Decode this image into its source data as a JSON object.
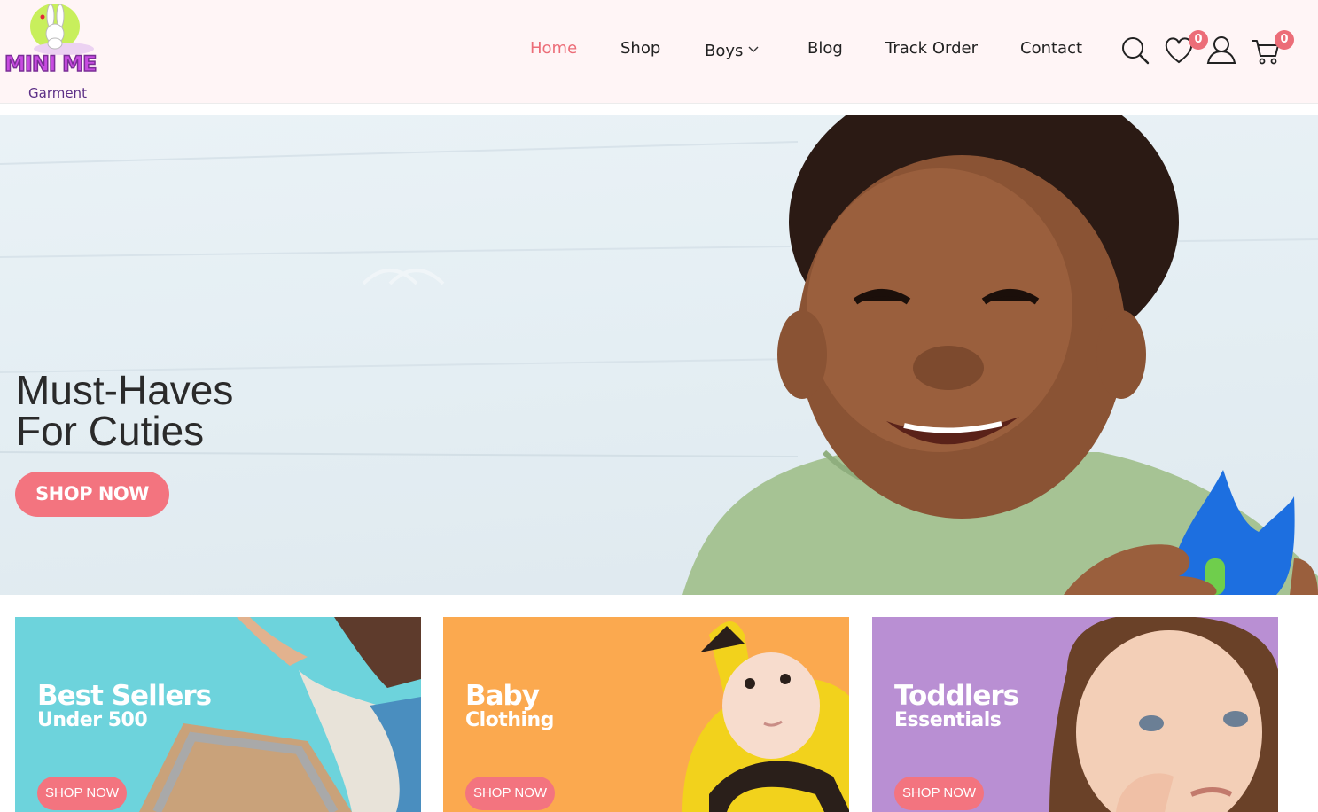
{
  "brand": {
    "logo_text": "MINI ME",
    "logo_subtext": "Garment"
  },
  "nav": {
    "items": [
      {
        "label": "Home",
        "active": true
      },
      {
        "label": "Shop",
        "active": false
      },
      {
        "label": "Boys",
        "active": false,
        "has_dropdown": true
      },
      {
        "label": "Blog",
        "active": false
      },
      {
        "label": "Track Order",
        "active": false
      },
      {
        "label": "Contact",
        "active": false
      }
    ]
  },
  "header_icons": {
    "search": "search-icon",
    "wishlist": "heart-icon",
    "wishlist_count": "0",
    "account": "user-icon",
    "cart": "cart-icon",
    "cart_count": "0"
  },
  "hero": {
    "title": "Must-Haves\nFor Cuties",
    "button_label": "SHOP NOW"
  },
  "categories": [
    {
      "title": "Best Sellers",
      "subtitle": "Under 500",
      "button_label": "SHOP NOW",
      "bg_color": "#6dd3dc"
    },
    {
      "title": "Baby",
      "subtitle": "Clothing",
      "button_label": "SHOP NOW",
      "bg_color": "#fba94f"
    },
    {
      "title": "Toddlers",
      "subtitle": "Essentials",
      "button_label": "SHOP NOW",
      "bg_color": "#b98fd3"
    }
  ],
  "colors": {
    "accent": "#f3747f",
    "active_nav": "#ec6d78",
    "header_bg": "#fff5f6"
  }
}
